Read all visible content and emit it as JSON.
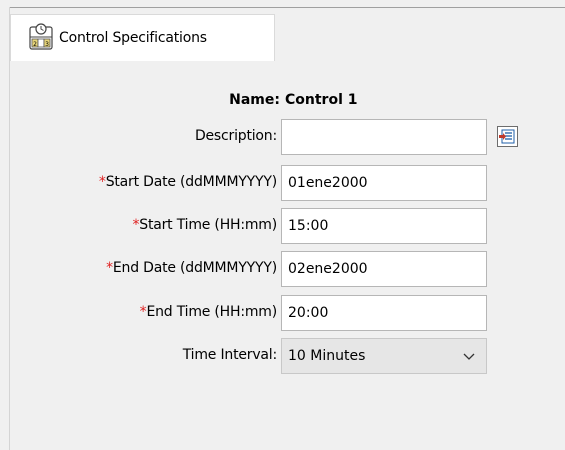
{
  "tab": {
    "label": "Control Specifications",
    "icon": "calendar-control-icon"
  },
  "name": {
    "label": "Name:",
    "value": "Control 1"
  },
  "fields": {
    "description": {
      "label": "Description:",
      "value": ""
    },
    "start_date": {
      "required_mark": "*",
      "label": "Start Date (ddMMMYYYY)",
      "value": "01ene2000"
    },
    "start_time": {
      "required_mark": "*",
      "label": "Start Time (HH:mm)",
      "value": "15:00"
    },
    "end_date": {
      "required_mark": "*",
      "label": "End Date (ddMMMYYYY)",
      "value": "02ene2000"
    },
    "end_time": {
      "required_mark": "*",
      "label": "End Time (HH:mm)",
      "value": "20:00"
    },
    "time_interval": {
      "label": "Time Interval:",
      "value": "10 Minutes"
    }
  },
  "colors": {
    "required": "#e02020",
    "background": "#f0f0f0",
    "field_border": "#b6b6b6"
  }
}
